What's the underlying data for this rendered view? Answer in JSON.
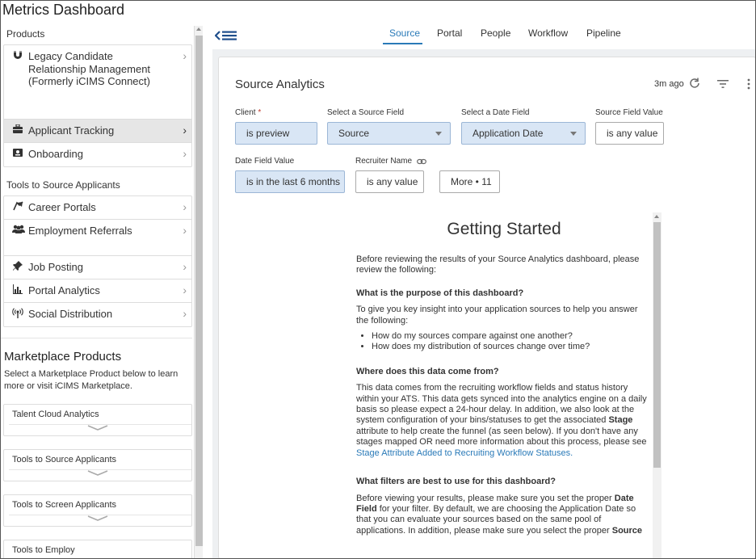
{
  "app": {
    "title": "Metrics Dashboard"
  },
  "sidebar": {
    "products_heading": "Products",
    "products": [
      {
        "label": "Legacy Candidate Relationship Management (Formerly iCIMS Connect)",
        "icon": "magnet-icon"
      },
      {
        "label": "Applicant Tracking",
        "icon": "briefcase-icon",
        "active": true
      },
      {
        "label": "Onboarding",
        "icon": "id-card-icon"
      }
    ],
    "tools_heading": "Tools to Source Applicants",
    "tools": [
      {
        "label": "Career Portals",
        "icon": "flag-icon"
      },
      {
        "label": "Employment Referrals",
        "icon": "people-icon"
      },
      {
        "label": "Job Posting",
        "icon": "pin-icon"
      },
      {
        "label": "Portal Analytics",
        "icon": "bar-chart-icon"
      },
      {
        "label": "Social Distribution",
        "icon": "broadcast-icon"
      }
    ],
    "marketplace": {
      "title": "Marketplace Products",
      "description": "Select a Marketplace Product below to learn more or visit iCIMS Marketplace.",
      "cards": [
        "Talent Cloud Analytics",
        "Tools to Source Applicants",
        "Tools to Screen Applicants",
        "Tools to Employ"
      ]
    }
  },
  "tabs": [
    {
      "label": "Source",
      "active": true
    },
    {
      "label": "Portal"
    },
    {
      "label": "People"
    },
    {
      "label": "Workflow"
    },
    {
      "label": "Pipeline"
    }
  ],
  "panel": {
    "title": "Source Analytics",
    "updated": "3m ago",
    "filters": {
      "client": {
        "label": "Client",
        "required_mark": "*",
        "value": "is preview"
      },
      "source_field": {
        "label": "Select a Source Field",
        "value": "Source"
      },
      "date_field": {
        "label": "Select a Date Field",
        "value": "Application Date"
      },
      "source_field_value": {
        "label": "Source Field Value",
        "value": "is any value"
      },
      "date_field_value": {
        "label": "Date Field Value",
        "value": "is in the last 6 months"
      },
      "recruiter_name": {
        "label": "Recruiter Name",
        "value": "is any value"
      },
      "more": {
        "label": "More • 11"
      }
    }
  },
  "getting_started": {
    "title": "Getting Started",
    "intro": "Before reviewing the results of your Source Analytics dashboard, please review the following:",
    "q1": "What is the purpose of this dashboard?",
    "a1": "To give you key insight into your application sources to help you answer the following:",
    "bullets": [
      "How do my sources compare against one another?",
      "How does my distribution of sources change over time?"
    ],
    "q2": "Where does this data come from?",
    "a2_part1": "This data comes from the recruiting workflow fields and status history within your ATS. This data gets synced into the analytics engine on a daily basis so please expect a 24-hour delay. In addition, we also look at the system configuration of your bins/statuses to get the associated ",
    "a2_bold": "Stage",
    "a2_part2": " attribute to help create the funnel (as seen below). If you don't have any stages mapped OR need more information about this process, please see ",
    "a2_link": "Stage Attribute Added to Recruiting Workflow Statuses.",
    "q3": "What filters are best to use for this dashboard?",
    "a3_part1": "Before viewing your results, please make sure you set the proper ",
    "a3_bold1": "Date Field",
    "a3_part2": " for your filter. By default, we are choosing the Application Date so that you can evaluate your sources based on the same pool of applications. In addition, please make sure you select the proper ",
    "a3_bold2": "Source"
  }
}
